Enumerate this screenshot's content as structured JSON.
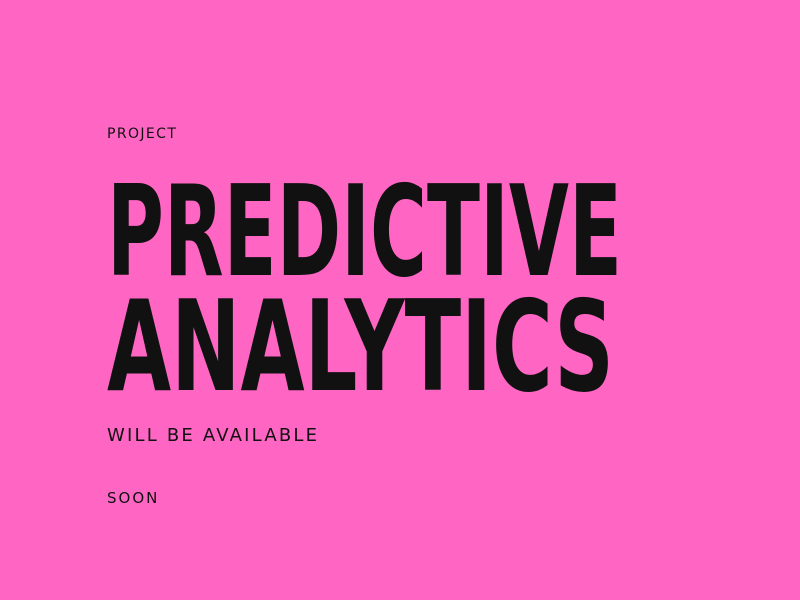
{
  "poster": {
    "background_color": "#ff66c4",
    "text_color": "#111111",
    "eyebrow": "PROJECT",
    "headline_line_1": "PREDICTIVE",
    "headline_line_2": "ANALYTICS",
    "tagline": "WILL BE AVAILABLE",
    "footnote": "SOON"
  }
}
